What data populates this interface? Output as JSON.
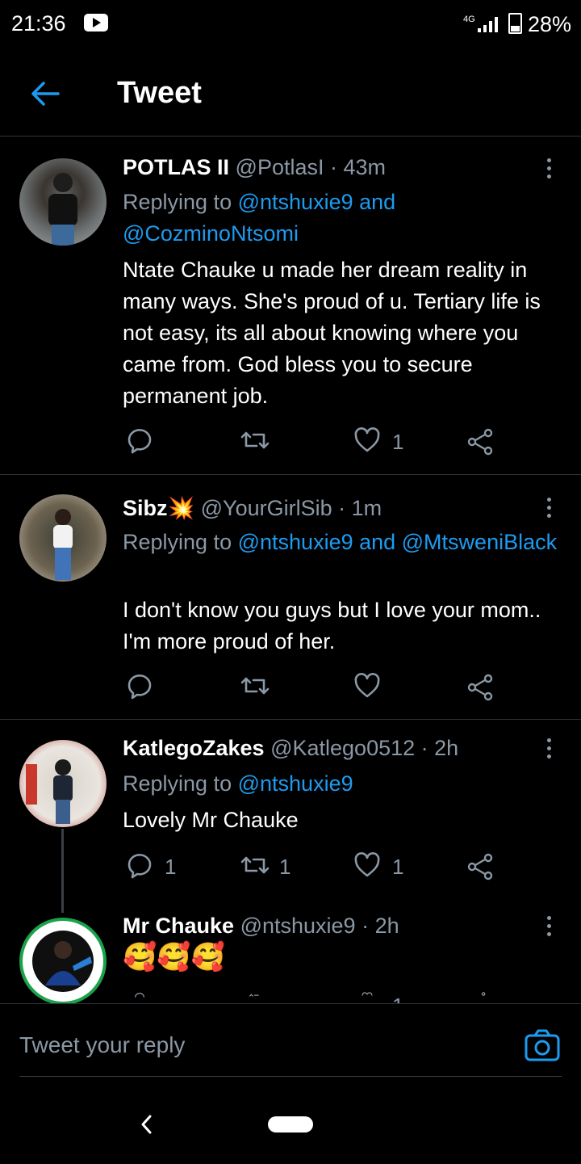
{
  "status": {
    "time": "21:36",
    "network": "4G",
    "battery": "28%"
  },
  "header": {
    "title": "Tweet"
  },
  "tweets": [
    {
      "name": "POTLAS II",
      "handle": "@PotlasI",
      "time": "· 43m",
      "replying_prefix": "Replying to",
      "replying_to": "@ntshuxie9 and @CozminoNtsomi",
      "text": "Ntate Chauke u made her dream reality in many ways. She's proud of u. Tertiary life is not easy, its all about knowing where you came from. God bless you to secure permanent job.",
      "replies": "",
      "retweets": "",
      "likes": "1"
    },
    {
      "name": "Sibz💥",
      "handle": "@YourGirlSib",
      "time": "· 1m",
      "replying_prefix": "Replying to",
      "replying_to": "@ntshuxie9 and @MtsweniBlack",
      "text": "I don't know you guys but I love your mom.. I'm more proud of her.",
      "replies": "",
      "retweets": "",
      "likes": ""
    },
    {
      "name": "KatlegoZakes",
      "handle": "@Katlego0512",
      "time": "· 2h",
      "replying_prefix": "Replying to",
      "replying_to": "@ntshuxie9",
      "text": "Lovely Mr Chauke",
      "replies": "1",
      "retweets": "1",
      "likes": "1"
    },
    {
      "name": "Mr Chauke",
      "handle": "@ntshuxie9",
      "time": "· 2h",
      "text": "🥰🥰🥰",
      "replies": "",
      "retweets": "",
      "likes": "1"
    }
  ],
  "compose": {
    "placeholder": "Tweet your reply"
  },
  "icons": {
    "accent": "#1d9bf0",
    "muted": "#8b98a5"
  }
}
